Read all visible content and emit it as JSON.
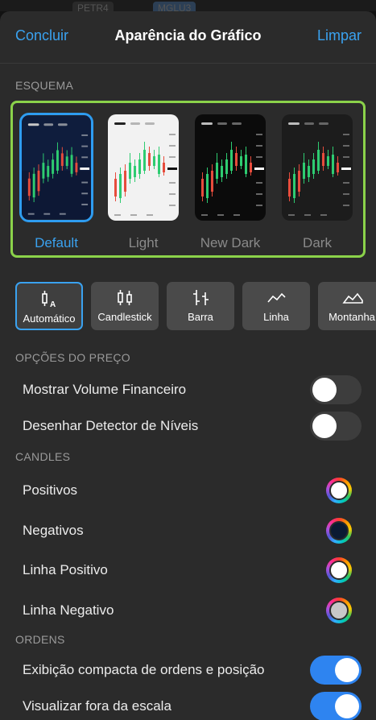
{
  "topbar": {
    "tab1": "PETR4",
    "tab2": "MGLU3"
  },
  "header": {
    "done": "Concluir",
    "title": "Aparência do Gráfico",
    "clear": "Limpar"
  },
  "schemes": {
    "title": "ESQUEMA",
    "items": [
      {
        "label": "Default",
        "bg": "#0d1a33",
        "selected": true
      },
      {
        "label": "Light",
        "bg": "#f2f2f2",
        "selected": false
      },
      {
        "label": "New Dark",
        "bg": "#0b0b0b",
        "selected": false
      },
      {
        "label": "Dark",
        "bg": "#1a1a1a",
        "selected": false
      }
    ]
  },
  "chart_types": [
    {
      "label": "Automático",
      "icon": "auto-chart-icon",
      "selected": true
    },
    {
      "label": "Candlestick",
      "icon": "candlestick-icon",
      "selected": false
    },
    {
      "label": "Barra",
      "icon": "bar-chart-icon",
      "selected": false
    },
    {
      "label": "Linha",
      "icon": "line-chart-icon",
      "selected": false
    },
    {
      "label": "Montanha",
      "icon": "mountain-chart-icon",
      "selected": false
    }
  ],
  "price_options": {
    "title": "OPÇÕES DO PREÇO",
    "show_volume": {
      "label": "Mostrar Volume Financeiro",
      "enabled": false
    },
    "level_detector": {
      "label": "Desenhar Detector de Níveis",
      "enabled": false
    }
  },
  "candles": {
    "title": "CANDLES",
    "positive": {
      "label": "Positivos",
      "color": "#ffffff"
    },
    "negative": {
      "label": "Negativos",
      "color": "#0b1a33"
    },
    "line_positive": {
      "label": "Linha Positivo",
      "color": "#ffffff"
    },
    "line_negative": {
      "label": "Linha Negativo",
      "color": "#c8c8c8"
    }
  },
  "orders": {
    "title": "ORDENS",
    "compact": {
      "label": "Exibição compacta de ordens e posição",
      "enabled": true
    },
    "out_of_scale": {
      "label": "Visualizar fora da escala",
      "enabled": true
    }
  },
  "colors": {
    "accent": "#3aa2f0",
    "highlight": "#8bd24a",
    "toggle_on": "#2e84f0",
    "up_candle": "#2ecc71",
    "down_candle": "#e74c3c"
  }
}
